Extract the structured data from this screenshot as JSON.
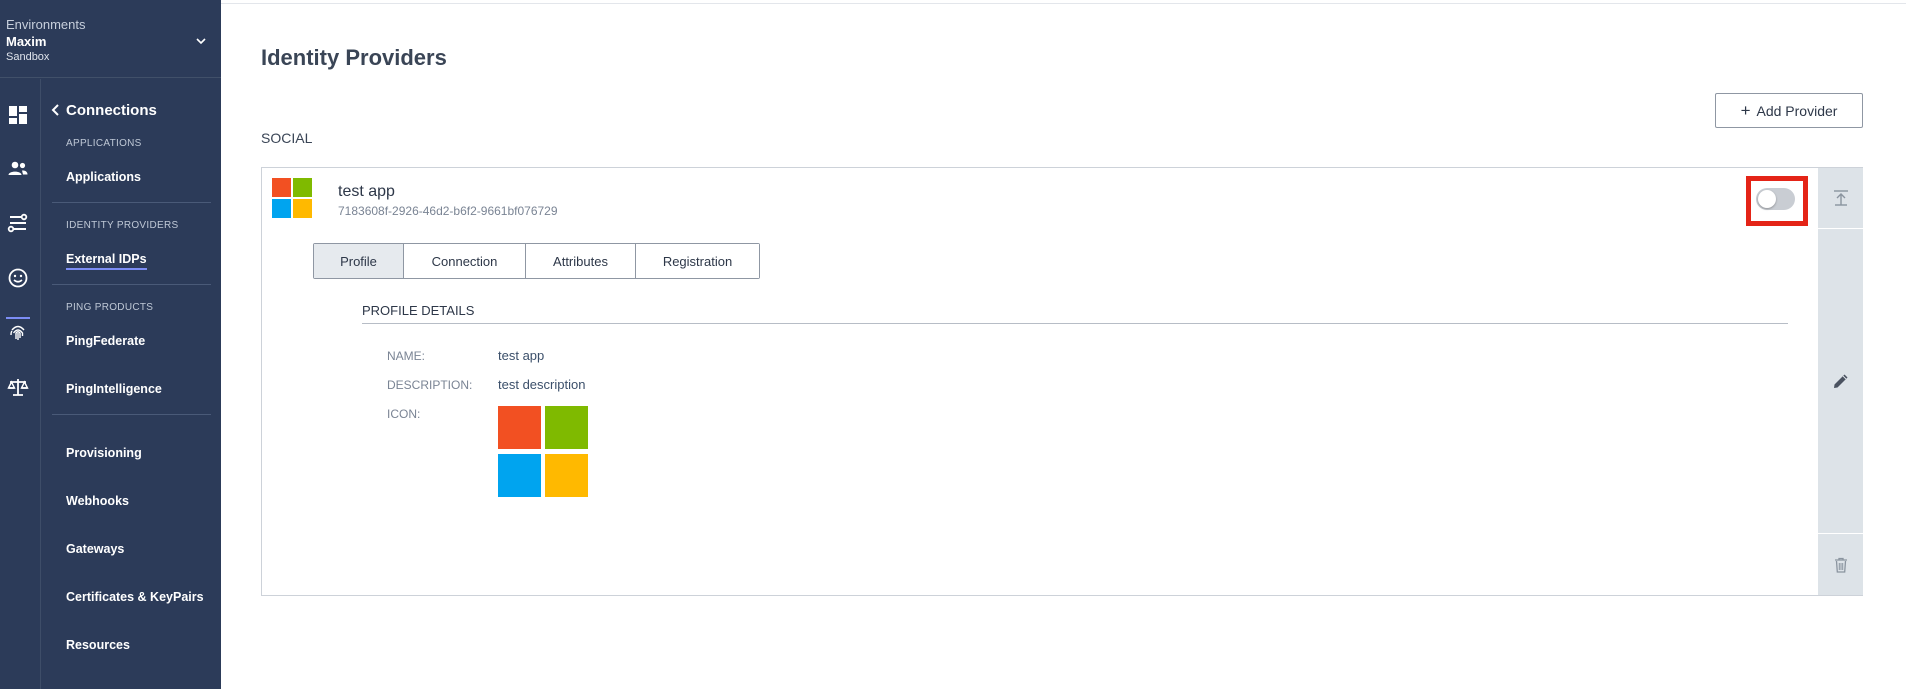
{
  "environment": {
    "label": "Environments",
    "name": "Maxim",
    "type": "Sandbox"
  },
  "rail_icons": [
    "dashboard-icon",
    "users-icon",
    "connections-icon",
    "experiences-icon",
    "fingerprint-icon",
    "balance-scale-icon"
  ],
  "nav": {
    "back_label": "Connections",
    "sections": [
      {
        "header": "APPLICATIONS",
        "items": [
          "Applications"
        ]
      },
      {
        "header": "IDENTITY PROVIDERS",
        "items": [
          "External IDPs"
        ]
      },
      {
        "header": "PING PRODUCTS",
        "items": [
          "PingFederate",
          "PingIntelligence"
        ]
      }
    ],
    "extra_items": [
      "Provisioning",
      "Webhooks",
      "Gateways",
      "Certificates & KeyPairs",
      "Resources"
    ],
    "active_item": "External IDPs"
  },
  "page": {
    "title": "Identity Providers",
    "add_provider_label": "Add Provider",
    "section_label": "SOCIAL"
  },
  "provider": {
    "name": "test app",
    "id": "7183608f-2926-46d2-b6f2-9661bf076729",
    "enabled": false,
    "tabs": [
      "Profile",
      "Connection",
      "Attributes",
      "Registration"
    ],
    "active_tab": "Profile",
    "details_title": "PROFILE DETAILS",
    "details": {
      "name_label": "NAME:",
      "name_value": "test app",
      "description_label": "DESCRIPTION:",
      "description_value": "test description",
      "icon_label": "ICON:"
    },
    "logo_colors": [
      "#f25022",
      "#7fba00",
      "#00a4ef",
      "#ffb900"
    ]
  },
  "colors": {
    "sidebar": "#2c3b59",
    "accent": "#7c8df5",
    "highlight": "#e42417"
  }
}
